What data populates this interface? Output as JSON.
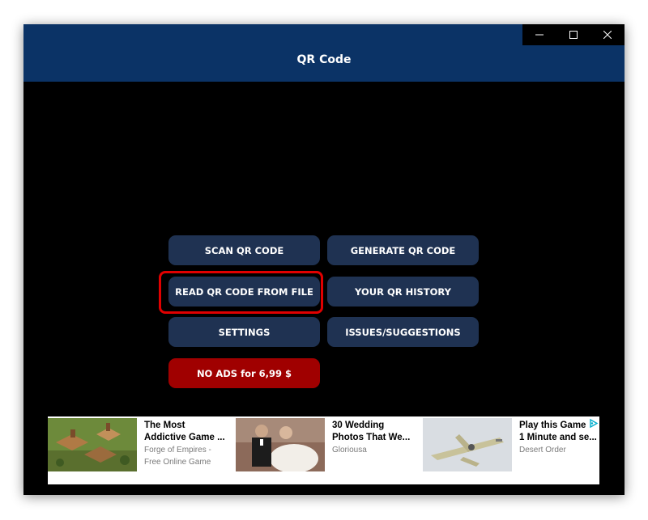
{
  "window": {
    "title": "QR Code",
    "controls": {
      "minimize": "minimize-icon",
      "maximize": "maximize-icon",
      "close": "close-icon"
    }
  },
  "menu": {
    "scan": "SCAN QR CODE",
    "generate": "GENERATE QR CODE",
    "read_file": "READ QR CODE FROM FILE",
    "history": "YOUR QR HISTORY",
    "settings": "SETTINGS",
    "issues": "ISSUES/SUGGESTIONS",
    "no_ads": "NO ADS for 6,99 $"
  },
  "colors": {
    "titlebar": "#0b3366",
    "button": "#1f3252",
    "no_ads_button": "#a00000",
    "highlight": "#e00000"
  },
  "ads": [
    {
      "title_line1": "The Most",
      "title_line2": "Addictive Game ...",
      "source_line1": "Forge of Empires -",
      "source_line2": "Free Online Game"
    },
    {
      "title_line1": "30 Wedding",
      "title_line2": "Photos That We...",
      "source_line1": "Gloriousa",
      "source_line2": ""
    },
    {
      "title_line1": "Play this Game f",
      "title_line2": "1 Minute and se...",
      "source_line1": "Desert Order",
      "source_line2": ""
    }
  ],
  "ad_choices_icon": "ad-choices-icon"
}
